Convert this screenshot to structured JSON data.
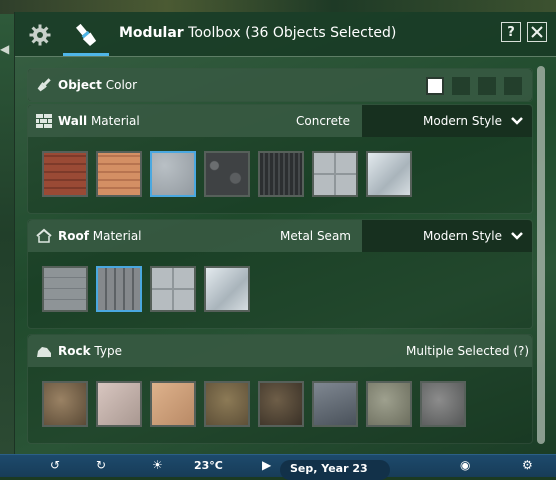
{
  "window": {
    "title_bold": "Modular",
    "title_rest": " Toolbox (36 Objects Selected)",
    "help_label": "?",
    "tabs": [
      {
        "name": "settings",
        "icon": "gear-icon",
        "active": false
      },
      {
        "name": "modular-toolbox",
        "icon": "paintbrush-icon",
        "active": true
      }
    ]
  },
  "object_color": {
    "title_bold": "Object",
    "title_rest": " Color",
    "icon": "paint-brush-icon",
    "colors": [
      "#ffffff",
      "#233f2c",
      "#233f2c",
      "#233f2c"
    ],
    "selected_index": 0
  },
  "wall_material": {
    "title_bold": "Wall",
    "title_rest": " Material",
    "icon": "brick-wall-icon",
    "value": "Concrete",
    "style": "Modern Style",
    "swatches": [
      {
        "name": "red-wood-planks",
        "selected": false
      },
      {
        "name": "light-wood-planks",
        "selected": false
      },
      {
        "name": "concrete",
        "selected": true
      },
      {
        "name": "dark-stone",
        "selected": false
      },
      {
        "name": "dark-ribbed-metal",
        "selected": false
      },
      {
        "name": "grey-tiles",
        "selected": false
      },
      {
        "name": "glass",
        "selected": false
      }
    ]
  },
  "roof_material": {
    "title_bold": "Roof",
    "title_rest": " Material",
    "icon": "house-roof-icon",
    "value": "Metal Seam",
    "style": "Modern Style",
    "swatches": [
      {
        "name": "grey-panels",
        "selected": false
      },
      {
        "name": "metal-seam",
        "selected": true
      },
      {
        "name": "grey-tiles",
        "selected": false
      },
      {
        "name": "glass",
        "selected": false
      }
    ]
  },
  "rock_type": {
    "title_bold": "Rock",
    "title_rest": " Type",
    "icon": "rock-icon",
    "value": "Multiple Selected (?)",
    "swatches": [
      {
        "name": "brown-rock",
        "selected": false
      },
      {
        "name": "pale-pink-rock",
        "selected": false
      },
      {
        "name": "sandstone",
        "selected": false
      },
      {
        "name": "olive-rock",
        "selected": false
      },
      {
        "name": "dark-brown-rock",
        "selected": false
      },
      {
        "name": "slate-rock",
        "selected": false
      },
      {
        "name": "mossy-rock",
        "selected": false
      },
      {
        "name": "grey-granite",
        "selected": false
      }
    ]
  },
  "footer": {
    "temperature": "23°C",
    "date": "Sep, Year 23"
  },
  "colors": {
    "accent": "#4aa8e0",
    "panel_green": "#1f4a2c"
  }
}
